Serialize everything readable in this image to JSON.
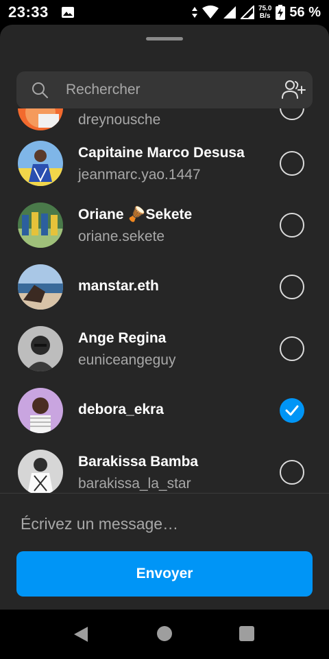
{
  "status_bar": {
    "time": "23:33",
    "net_speed_value": "75.0",
    "net_speed_unit": "B/s",
    "battery_percent": "56 %"
  },
  "search": {
    "placeholder": "Rechercher"
  },
  "contacts": [
    {
      "name": "",
      "username": "dreynousche",
      "selected": false
    },
    {
      "name": "Capitaine Marco Desusa",
      "username": "jeanmarc.yao.1447",
      "selected": false
    },
    {
      "name": "Oriane 🪘Sekete",
      "username": "oriane.sekete",
      "selected": false
    },
    {
      "name": "manstar.eth",
      "username": "",
      "selected": false
    },
    {
      "name": "Ange Regina",
      "username": "euniceangeguy",
      "selected": false
    },
    {
      "name": "debora_ekra",
      "username": "",
      "selected": true
    },
    {
      "name": "Barakissa Bamba",
      "username": "barakissa_la_star",
      "selected": false
    }
  ],
  "message": {
    "placeholder": "Écrivez un message…"
  },
  "send_button": {
    "label": "Envoyer"
  },
  "colors": {
    "accent": "#0095f6",
    "sheet_bg": "#262626",
    "search_bg": "#363636"
  }
}
